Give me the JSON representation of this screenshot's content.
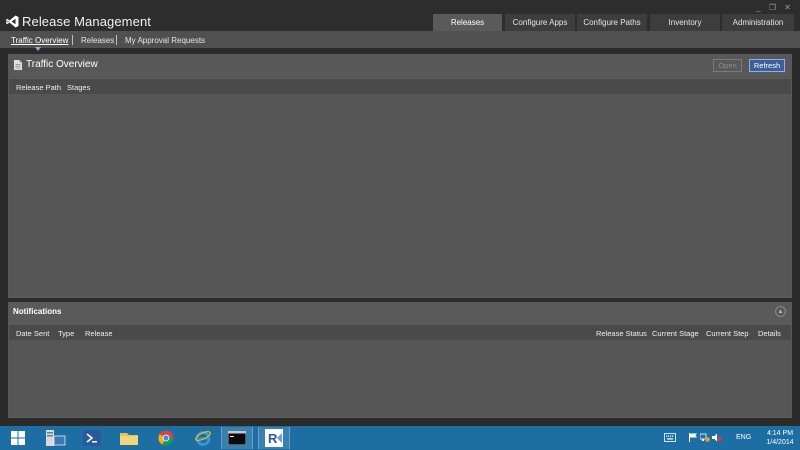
{
  "app": {
    "title": "Release Management"
  },
  "window_controls": {
    "minimize": "_",
    "restore": "❐",
    "close": "✕"
  },
  "tabs": [
    {
      "label": "Releases",
      "active": true
    },
    {
      "label": "Configure Apps",
      "active": false
    },
    {
      "label": "Configure Paths",
      "active": false
    },
    {
      "label": "Inventory",
      "active": false
    },
    {
      "label": "Administration",
      "active": false
    }
  ],
  "subnav": {
    "items": [
      {
        "label": "Traffic Overview",
        "active": true
      },
      {
        "label": "Releases",
        "active": false
      },
      {
        "label": "My Approval Requests",
        "active": false
      }
    ]
  },
  "traffic_panel": {
    "title": "Traffic Overview",
    "open_label": "Open",
    "refresh_label": "Refresh",
    "columns": [
      "Release Path",
      "Stages"
    ],
    "rows": []
  },
  "notifications": {
    "title": "Notifications",
    "collapse_icon": "chevron-up-icon",
    "columns": [
      "Date Sent",
      "Type",
      "Release",
      "Release Status",
      "Current Stage",
      "Current Step",
      "Details"
    ],
    "rows": []
  },
  "taskbar": {
    "apps": [
      "start-icon",
      "server-manager-icon",
      "powershell-icon",
      "file-explorer-icon",
      "chrome-icon",
      "internet-explorer-icon",
      "command-prompt-icon",
      "release-management-icon"
    ],
    "language": "ENG",
    "time": "4:14 PM",
    "date": "1/4/2014"
  },
  "colors": {
    "accent": "#1d6fa3",
    "refresh_button": "#3b5f9a",
    "panel_bg": "#5a5a5a",
    "chrome_bg": "#2d2d2d"
  }
}
